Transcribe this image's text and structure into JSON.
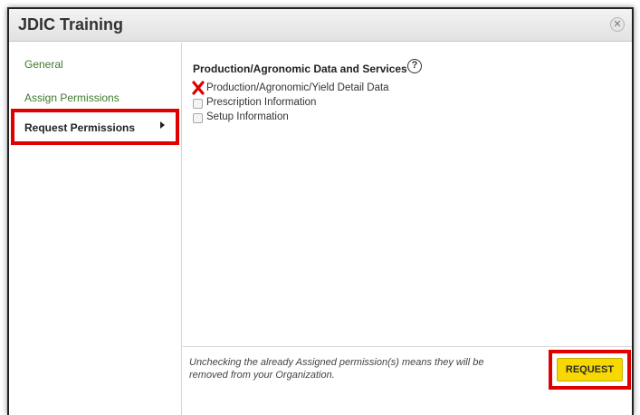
{
  "dialog": {
    "title": "JDIC Training",
    "close_icon": "close-icon"
  },
  "sidebar": {
    "items": [
      {
        "label": "General",
        "selected": false
      },
      {
        "label": "Assign Permissions",
        "selected": false
      },
      {
        "label": "Request Permissions",
        "selected": true
      }
    ]
  },
  "section": {
    "title": "Production/Agronomic Data and Services",
    "help_icon": "question-circle-icon",
    "help_glyph": "?",
    "permissions": [
      {
        "label": "Production/Agronomic/Yield Detail Data",
        "state": "unchecked-assigned"
      },
      {
        "label": "Prescription Information",
        "state": "unchecked"
      },
      {
        "label": "Setup Information",
        "state": "unchecked"
      }
    ]
  },
  "footer": {
    "note": "Unchecking the already Assigned permission(s) means they will be removed from your Organization.",
    "request_label": "REQUEST"
  },
  "colors": {
    "highlight": "#e00000",
    "link_green": "#3d7a2b",
    "button_yellow": "#f7d800"
  }
}
